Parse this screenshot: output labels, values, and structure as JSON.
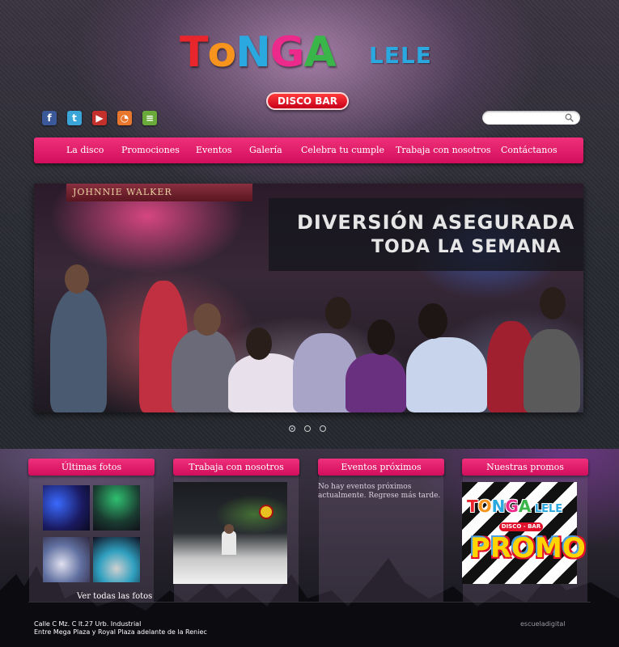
{
  "header": {
    "logo_letters": [
      {
        "ch": "T",
        "color": "#e8262c"
      },
      {
        "ch": "o",
        "color": "#f7941d"
      },
      {
        "ch": "N",
        "color": "#2aa8e0"
      },
      {
        "ch": "G",
        "color": "#ec2a8c"
      },
      {
        "ch": "A",
        "color": "#3ab54a"
      }
    ],
    "logo_sub": "LELE",
    "badge": "DISCO BAR"
  },
  "social": [
    {
      "name": "facebook-icon",
      "glyph": "f",
      "color": "#3b5998"
    },
    {
      "name": "twitter-icon",
      "glyph": "t",
      "color": "#3aa6d8"
    },
    {
      "name": "youtube-icon",
      "glyph": "▶",
      "color": "#c4302b"
    },
    {
      "name": "rss-icon",
      "glyph": "◔",
      "color": "#e8762d"
    },
    {
      "name": "share-icon",
      "glyph": "≡",
      "color": "#6aaa3a"
    }
  ],
  "search": {
    "placeholder": ""
  },
  "nav": {
    "items": [
      "La disco",
      "Promociones",
      "Eventos",
      "Galería",
      "Celebra tu cumple",
      "Trabaja con nosotros",
      "Contáctanos"
    ]
  },
  "slider": {
    "sign": "JOHNNIE WALKER",
    "caption_line1": "DIVERSIÓN ASEGURADA",
    "caption_line2": "TODA LA SEMANA",
    "dots": 3,
    "active_dot": 0
  },
  "panels": {
    "photos": {
      "title": "Últimas fotos",
      "more": "Ver todas las fotos"
    },
    "work": {
      "title": "Trabaja con nosotros"
    },
    "events": {
      "title": "Eventos próximos",
      "text": "No hay eventos próximos actualmente. Regrese más tarde."
    },
    "promos": {
      "title": "Nuestras promos",
      "promo_logo": "TONGA LELE",
      "promo_badge": "DISCO - BAR",
      "promo_word": "PROMO"
    }
  },
  "footer": {
    "address_line1": "Calle C Mz. C lt.27 Urb. Industrial",
    "address_line2": "Entre Mega Plaza y Royal Plaza adelante de la Reniec",
    "credit": "escueladigital"
  }
}
